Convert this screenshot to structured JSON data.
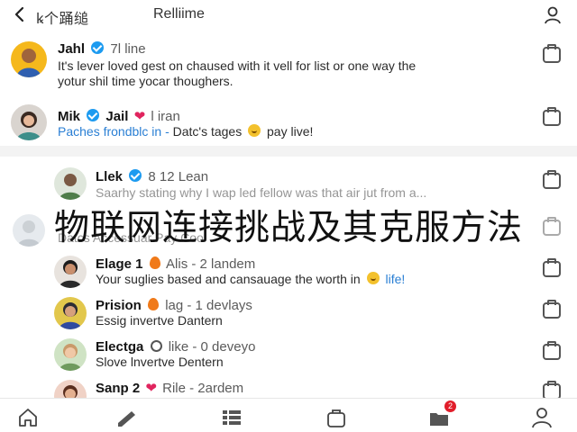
{
  "header": {
    "title": "ꝃ个踊缒",
    "subtitle": "Relliime",
    "back_icon": "chevron-left-icon",
    "profile_icon": "person-icon"
  },
  "feed": {
    "items": [
      {
        "name": "Jahl",
        "meta": "7l line",
        "badge": "verified-icon",
        "line1": "It's lever loved gest on chaused with it vell for list or one way the",
        "line2": "yotur shil time yocar thoughers."
      },
      {
        "name": "Mik",
        "name2": "Jail",
        "meta": "l iran",
        "badge": "verified-icon",
        "link": "Paches frondblc in -",
        "text": "Datc's tages",
        "tail": "pay live!"
      },
      {
        "name": "Llek",
        "meta": "8 12 Lean",
        "badge": "verified-icon",
        "line1": "Saarhy stating why I wap led fellow was that air jut from a..."
      },
      {
        "faded": "Datcs Accessuar  Pay Coo"
      },
      {
        "name": "Elage 1",
        "meta": "Alis - 2 landem",
        "line1": "Your suglies based and cansauage the worth in",
        "tail": "life!"
      },
      {
        "name": "Prision",
        "meta": "lag - 1 devlays",
        "line1": "Essig invertve Dantern"
      },
      {
        "name": "Electga",
        "meta": "like - 0 deveyo",
        "line1": "Slove lnvertve Dentern"
      },
      {
        "name": "Sanp 2",
        "meta": "Rile - 2ardem"
      }
    ]
  },
  "overlay": {
    "title": "物联网连接挑战及其克服方法"
  },
  "bottom_nav": {
    "items": [
      "home-icon",
      "pen-icon",
      "list-icon",
      "bag-icon",
      "messages-icon",
      "person-icon"
    ],
    "badge": "2"
  },
  "colors": {
    "accent": "#2a7fd4",
    "verified": "#1d9bf0",
    "heart": "#e0245e",
    "badge": "#e11d2a"
  }
}
